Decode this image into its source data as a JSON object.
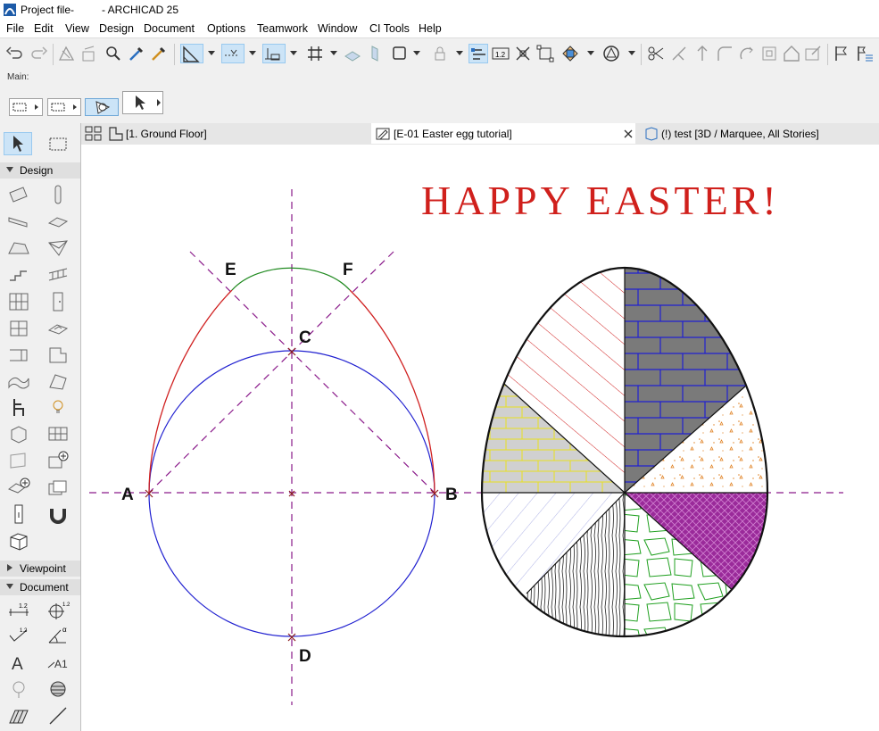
{
  "window": {
    "title_doc": "Project file-",
    "title_app": "- ARCHICAD 25"
  },
  "menu": [
    "File",
    "Edit",
    "View",
    "Design",
    "Document",
    "Options",
    "Teamwork",
    "Window",
    "CI Tools",
    "Help"
  ],
  "infobox": {
    "label": "Main:"
  },
  "tabs": [
    {
      "label": "[1. Ground Floor]"
    },
    {
      "label": "[E-01 Easter egg tutorial]"
    },
    {
      "label": "(!) test [3D / Marquee, All Stories]"
    }
  ],
  "toolbox": {
    "design_label": "Design",
    "viewpoint_label": "Viewpoint",
    "document_label": "Document"
  },
  "drawing": {
    "headline": "HAPPY  EASTER!",
    "point_labels": {
      "A": "A",
      "B": "B",
      "C": "C",
      "D": "D",
      "E": "E",
      "F": "F"
    },
    "colors": {
      "headline": "#d0201c",
      "circle": "#2020d0",
      "side_arcs": "#d02020",
      "top_arc": "#208a20",
      "guides": "#8a1a8a"
    }
  }
}
